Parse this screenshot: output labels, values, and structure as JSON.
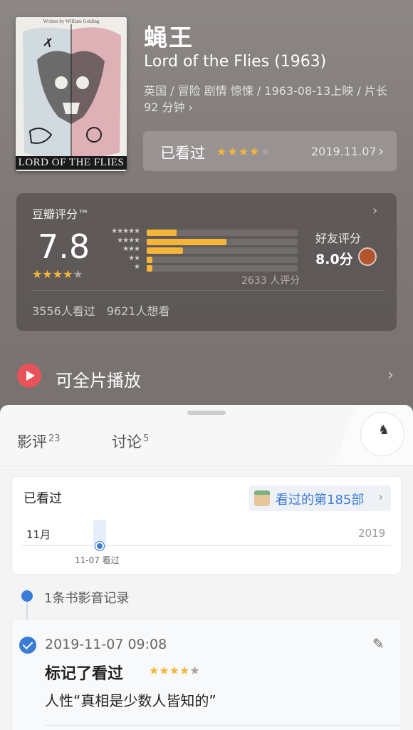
{
  "movie": {
    "title_cn": "蝇王",
    "title_en": "Lord of the Flies (1963)",
    "meta": "英国 / 冒险 剧情 惊悚 / 1963-08-13上映 / 片长92 分钟 ›",
    "poster": {
      "credit": "Written by William Golding",
      "title": "LORD OF THE FLIES"
    }
  },
  "watched_bar": {
    "label": "已看过",
    "user_stars": 4,
    "stars_text": "★★★★★",
    "date": "2019.11.07",
    "chevron": "›"
  },
  "rating": {
    "label": "豆瓣评分™",
    "chevron": "›",
    "score": "7.8",
    "stars_text": "★★★★★",
    "score_stars": 4,
    "distribution": [
      {
        "stars": "★★★★★",
        "fraction": 0.2
      },
      {
        "stars": "★★★★",
        "fraction": 0.53
      },
      {
        "stars": "★★★",
        "fraction": 0.24
      },
      {
        "stars": "★★",
        "fraction": 0.04
      },
      {
        "stars": "★",
        "fraction": 0.04
      }
    ],
    "count_text": "2633 人评分",
    "friends_label": "好友评分",
    "friends_value": "8.0分",
    "watched_count": "3556人看过",
    "want_count": "9621人想看"
  },
  "play": {
    "label": "可全片播放",
    "chevron": "›",
    "icon": "play-icon"
  },
  "tabs": [
    {
      "label": "影评",
      "count": "23"
    },
    {
      "label": "讨论",
      "count": "5"
    }
  ],
  "timeline": {
    "title": "已看过",
    "pill_label": "看过的第185部",
    "pill_chevron": "›",
    "month": "11月",
    "year": "2019",
    "marker_label": "11-07 看过"
  },
  "records": {
    "header": "1条书影音记录",
    "entry": {
      "datetime": "2019-11-07 09:08",
      "mark": "标记了看过",
      "stars": 4,
      "stars_text": "★★★★★",
      "comment": "人性“真相是少数人皆知的”",
      "edit_icon": "✎"
    }
  },
  "colors": {
    "accent_blue": "#3b7cd6",
    "star": "#f5b538",
    "play": "#e8525b"
  }
}
